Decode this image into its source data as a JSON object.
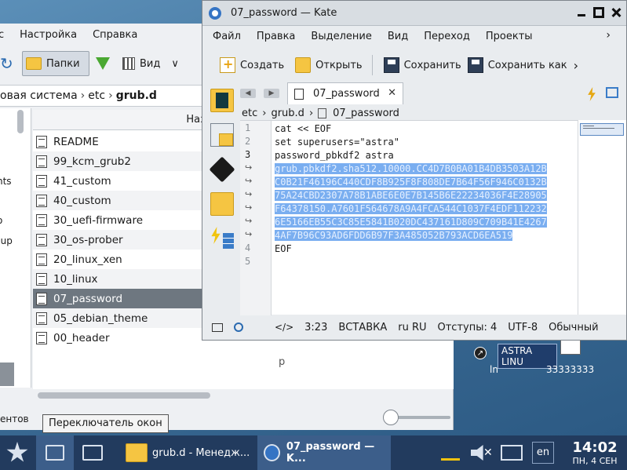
{
  "desktop": {
    "icon_astra_label": "ASTRA LINU",
    "icon_astra_sub": "ln",
    "icon_doc_label": "33333333"
  },
  "file_manager": {
    "menu": [
      "с",
      "Настройка",
      "Справка"
    ],
    "toolbar": {
      "folders_label": "Папки",
      "view_label": "Вид"
    },
    "path": {
      "part1": "овая система",
      "part2": "etc",
      "part3": "grub.d"
    },
    "left_panel_cut": [
      "nts",
      "o",
      "cup"
    ],
    "column_header": "Название",
    "files": [
      {
        "name": "README",
        "selected": false
      },
      {
        "name": "99_kcm_grub2",
        "selected": false
      },
      {
        "name": "41_custom",
        "selected": false
      },
      {
        "name": "40_custom",
        "selected": false
      },
      {
        "name": "30_uefi-firmware",
        "selected": false
      },
      {
        "name": "30_os-prober",
        "selected": false
      },
      {
        "name": "20_linux_xen",
        "selected": false
      },
      {
        "name": "10_linux",
        "selected": false
      },
      {
        "name": "07_password",
        "selected": true
      },
      {
        "name": "05_debian_theme",
        "selected": false
      },
      {
        "name": "00_header",
        "selected": false
      }
    ],
    "extra_text": "р",
    "status_text": "ентов"
  },
  "tooltip": "Переключатель окон",
  "kate": {
    "title": "07_password  — Kate",
    "menu": [
      "Файл",
      "Правка",
      "Выделение",
      "Вид",
      "Переход",
      "Проекты"
    ],
    "toolbar": {
      "new_label": "Создать",
      "open_label": "Открыть",
      "save_label": "Сохранить",
      "save_as_label": "Сохранить как"
    },
    "tab_label": "07_password",
    "breadcrumb": {
      "p1": "etc",
      "p2": "grub.d",
      "p3": "07_password"
    },
    "line_numbers": [
      "1",
      "2",
      "3",
      "↪",
      "↪",
      "↪",
      "↪",
      "↪",
      "↪",
      "4",
      "5"
    ],
    "code": {
      "l1": "cat << EOF",
      "l2": "set superusers=\"astra\"",
      "l3": "password_pbkdf2 astra",
      "s1": "grub.pbkdf2.sha512.10000.CC4D7B0BA01B4DB3503A12B",
      "s2": "C0B21F46196C440CDF8B925F8F808DE7B64F56F946C0132B",
      "s3": "75A24CBD2307A78B1ABE6E0E7B145B6E22234036F4E28905",
      "s4": "F64378150.A7601F564678A9A4FCA544C1037F4EDF112232",
      "s5": "6E5166EB55C3C85E5841B020DC437161D809C709B41E4267",
      "s6": "4AF7B96C93AD6FDD6B97F3A485052B793ACD6EA519",
      "l4": "EOF"
    },
    "status": {
      "position": "3:23",
      "mode": "ВСТАВКА",
      "lang": "ru  RU",
      "indent": "Отступы: 4",
      "encoding": "UTF-8",
      "syntax": "Обычный"
    }
  },
  "taskbar": {
    "fm_task": "grub.d - Менедж...",
    "kate_task": "07_password — K...",
    "lang": "en",
    "time": "14:02",
    "date": "ПН, 4 СЕН"
  },
  "colors": {
    "taskbar": "#223b5e",
    "selection": "#7aaef0",
    "accent": "#3574c4"
  }
}
